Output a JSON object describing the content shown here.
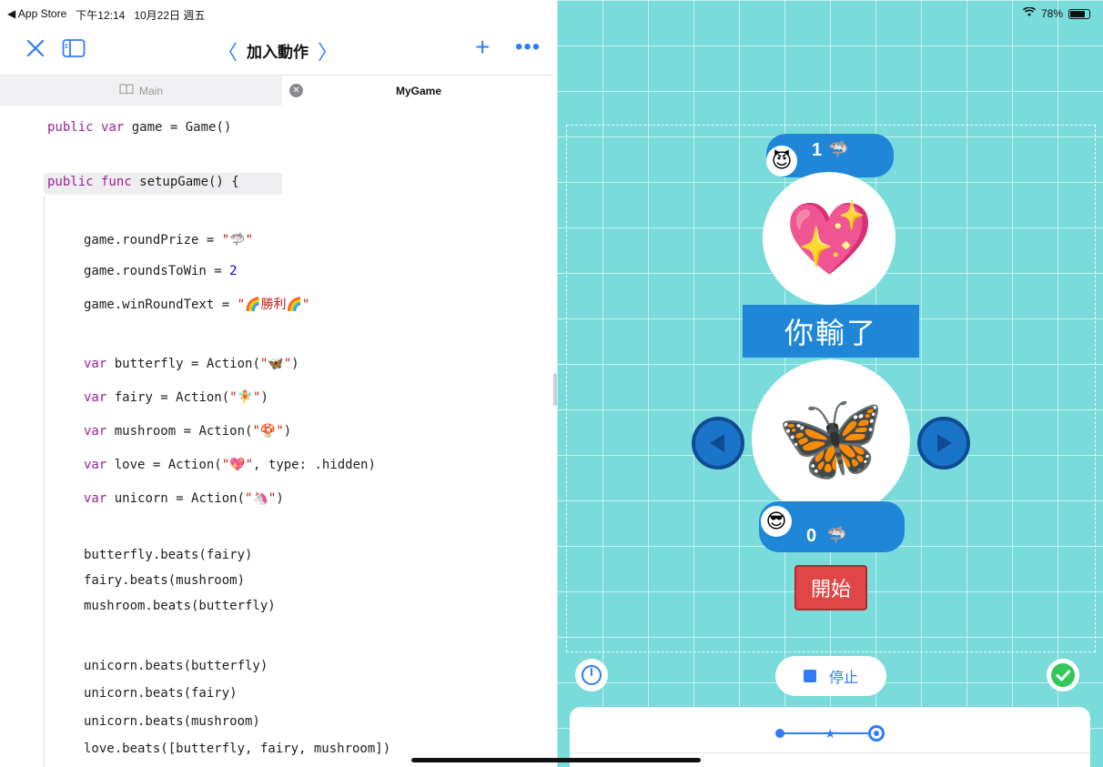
{
  "status_bar": {
    "back_app": "◀ App Store",
    "time": "下午12:14",
    "date": "10月22日 週五",
    "battery": "78%"
  },
  "toolbar": {
    "title": "加入動作",
    "icons": [
      "close-icon",
      "sidebar-icon",
      "chevron-left-icon",
      "chevron-right-icon",
      "plus-icon",
      "more-icon"
    ]
  },
  "tabs": [
    {
      "label": "Main",
      "active": false
    },
    {
      "label": "MyGame",
      "active": true
    }
  ],
  "code": {
    "l1": {
      "kw": "public var",
      "rest": " game = Game()"
    },
    "l2": {
      "kw": "public func",
      "rest": " setupGame() {"
    },
    "l3": {
      "prop": "game.roundPrize = ",
      "val": "\"🦈\""
    },
    "l4": {
      "prop": "game.roundsToWin = ",
      "val": "2"
    },
    "l5": {
      "prop": "game.winRoundText = ",
      "val": "\"🌈勝利🌈\""
    },
    "l6": {
      "kw": "var",
      "rest": " butterfly = Action(",
      "str": "\"🦋\"",
      "tail": ")"
    },
    "l7": {
      "kw": "var",
      "rest": " fairy = Action(",
      "str": "\"🧚\"",
      "tail": ")"
    },
    "l8": {
      "kw": "var",
      "rest": " mushroom = Action(",
      "str": "\"🍄\"",
      "tail": ")"
    },
    "l9": {
      "kw": "var",
      "rest": " love = Action(",
      "str": "\"💖\"",
      "tail": ", type: .hidden)"
    },
    "l10": {
      "kw": "var",
      "rest": " unicorn = Action(",
      "str": "\"🦄\"",
      "tail": ")"
    },
    "l11": "butterfly.beats(fairy)",
    "l12": "fairy.beats(mushroom)",
    "l13": "mushroom.beats(butterfly)",
    "l14": "unicorn.beats(butterfly)",
    "l15": "unicorn.beats(fairy)",
    "l16": "unicorn.beats(mushroom)",
    "l17": "love.beats([butterfly, fairy, mushroom])"
  },
  "game": {
    "opponent_avatar": "😈",
    "opponent_score": "1",
    "player_avatar": "😎",
    "player_score": "0",
    "prize_icon": "🦈",
    "opponent_choice": "💖",
    "player_choice": "🦋",
    "result_text": "你輸了",
    "start_label": "開始",
    "stop_label": "停止"
  },
  "colors": {
    "accent": "#2f7cf6",
    "game_bg": "#79dcdb",
    "banner_blue": "#1f86d8",
    "start_red": "#e14646",
    "check_green": "#34c759"
  }
}
